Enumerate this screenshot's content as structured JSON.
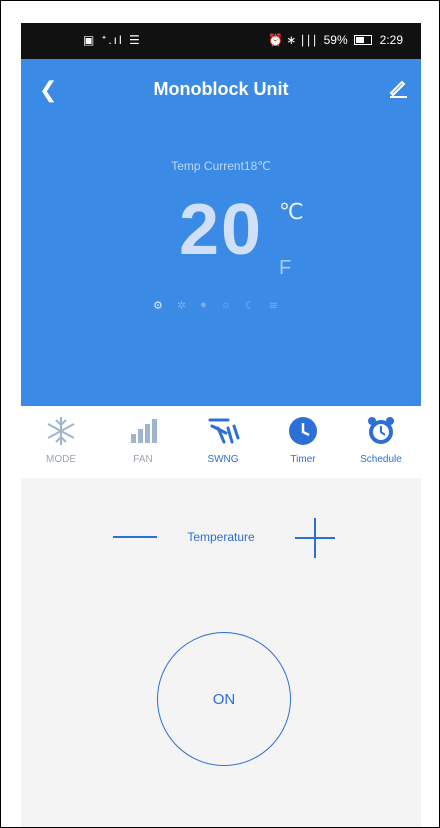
{
  "status_bar": {
    "left": "▣ ᐩ.ıl ☰",
    "right_icons": "⏰ ∗ ∣∣∣",
    "battery": "59%",
    "time": "2:29"
  },
  "header": {
    "title": "Monoblock Unit",
    "back_icon": "chevron-left-icon",
    "edit_icon": "edit-icon"
  },
  "temperature": {
    "current_label": "Temp Current18℃",
    "setpoint": "20",
    "unit_c": "℃",
    "unit_f": "F"
  },
  "toolbar": {
    "items": [
      {
        "label": "MODE",
        "icon": "snowflake-icon",
        "state": "inactive"
      },
      {
        "label": "FAN",
        "icon": "fan-signal-icon",
        "state": "inactive"
      },
      {
        "label": "SWNG",
        "icon": "swing-icon",
        "state": "active"
      },
      {
        "label": "Timer",
        "icon": "clock-icon",
        "state": "active"
      },
      {
        "label": "Schedule",
        "icon": "alarm-clock-icon",
        "state": "active"
      }
    ]
  },
  "controls": {
    "temperature_label": "Temperature"
  },
  "power": {
    "label": "ON"
  }
}
